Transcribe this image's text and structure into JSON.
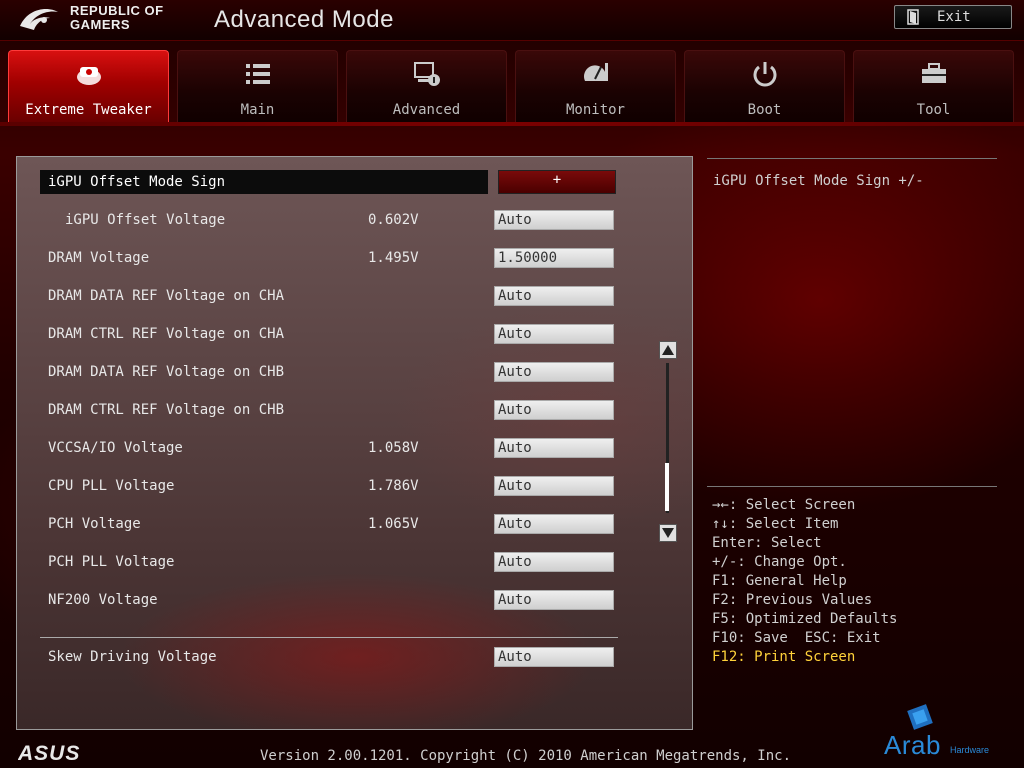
{
  "header": {
    "brand_line1": "REPUBLIC OF",
    "brand_line2": "GAMERS",
    "mode_title": "Advanced Mode",
    "exit_label": "Exit"
  },
  "tabs": [
    {
      "label": "Extreme Tweaker",
      "icon": "tweaker-icon",
      "active": true
    },
    {
      "label": "Main",
      "icon": "list-icon",
      "active": false
    },
    {
      "label": "Advanced",
      "icon": "advanced-icon",
      "active": false
    },
    {
      "label": "Monitor",
      "icon": "monitor-gauge-icon",
      "active": false
    },
    {
      "label": "Boot",
      "icon": "power-icon",
      "active": false
    },
    {
      "label": "Tool",
      "icon": "toolbox-icon",
      "active": false
    }
  ],
  "settings": [
    {
      "label": "iGPU Offset Mode Sign",
      "reading": "",
      "value": "+",
      "selected": true
    },
    {
      "label": "iGPU Offset Voltage",
      "reading": "0.602V",
      "value": "Auto",
      "indent": true
    },
    {
      "label": "DRAM Voltage",
      "reading": "1.495V",
      "value": "1.50000"
    },
    {
      "label": "DRAM DATA REF Voltage on CHA",
      "reading": "",
      "value": "Auto"
    },
    {
      "label": "DRAM CTRL REF Voltage on CHA",
      "reading": "",
      "value": "Auto"
    },
    {
      "label": "DRAM DATA REF Voltage on CHB",
      "reading": "",
      "value": "Auto"
    },
    {
      "label": "DRAM CTRL REF Voltage on CHB",
      "reading": "",
      "value": "Auto"
    },
    {
      "label": "VCCSA/IO Voltage",
      "reading": "1.058V",
      "value": "Auto"
    },
    {
      "label": "CPU PLL Voltage",
      "reading": "1.786V",
      "value": "Auto"
    },
    {
      "label": "PCH Voltage",
      "reading": "1.065V",
      "value": "Auto"
    },
    {
      "label": "PCH PLL Voltage",
      "reading": "",
      "value": "Auto"
    },
    {
      "label": "NF200 Voltage",
      "reading": "",
      "value": "Auto"
    },
    {
      "label": "Skew Driving Voltage",
      "reading": "",
      "value": "Auto"
    }
  ],
  "help": {
    "description": "iGPU Offset Mode Sign +/-"
  },
  "keys": [
    {
      "text": "→←: Select Screen",
      "highlight": false
    },
    {
      "text": "↑↓: Select Item",
      "highlight": false
    },
    {
      "text": "Enter: Select",
      "highlight": false
    },
    {
      "text": "+/-: Change Opt.",
      "highlight": false
    },
    {
      "text": "F1: General Help",
      "highlight": false
    },
    {
      "text": "F2: Previous Values",
      "highlight": false
    },
    {
      "text": "F5: Optimized Defaults",
      "highlight": false
    },
    {
      "text": "F10: Save  ESC: Exit",
      "highlight": false
    },
    {
      "text": "F12: Print Screen",
      "highlight": true
    }
  ],
  "footer": {
    "version": "Version 2.00.1201. Copyright (C) 2010 American Megatrends, Inc.",
    "brand": "ASUS"
  },
  "watermark": {
    "text": "Arab",
    "sub": "Hardware"
  },
  "colors": {
    "active_tab": "#c00000",
    "highlight_key": "#ffd23a",
    "watermark": "#2a8ad8"
  }
}
